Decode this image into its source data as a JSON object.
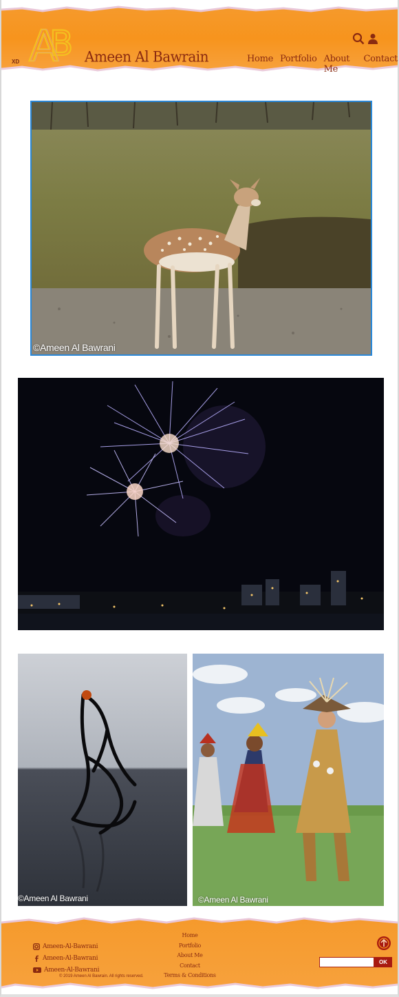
{
  "header": {
    "xd_label": "XD",
    "logo_letters": "AB",
    "brand": "Ameen Al Bawrain",
    "nav": [
      "Home",
      "Portfolio",
      "About Me",
      "Contact"
    ],
    "icons": [
      "search-icon",
      "user-icon"
    ]
  },
  "gallery": {
    "photo1": {
      "subject": "deer",
      "watermark": "©Ameen Al Bawrani"
    },
    "photo2": {
      "subject": "fireworks"
    },
    "photo3": {
      "subject": "sculpture",
      "watermark": "©Ameen Al Bawrani"
    },
    "photo4": {
      "subject": "powwow-dancers",
      "watermark": "©Ameen Al Bawrani"
    }
  },
  "footer": {
    "social": [
      {
        "icon": "instagram-icon",
        "label": "Ameen-Al-Bawrani"
      },
      {
        "icon": "facebook-icon",
        "label": "Ameen-Al-Bawrani"
      },
      {
        "icon": "youtube-icon",
        "label": "Ameen-Al-Bawrani"
      }
    ],
    "links": [
      "Home",
      "Portfolio",
      "About Me",
      "Contact",
      "Terms & Conditions"
    ],
    "copyright": "© 2019 Ameen Al Bawrain. All rights reserved.",
    "newsletter": {
      "placeholder": "",
      "button": "OK"
    }
  },
  "colors": {
    "accent": "#f7921e",
    "brand_text": "#8a2a10",
    "button": "#a81a10"
  }
}
